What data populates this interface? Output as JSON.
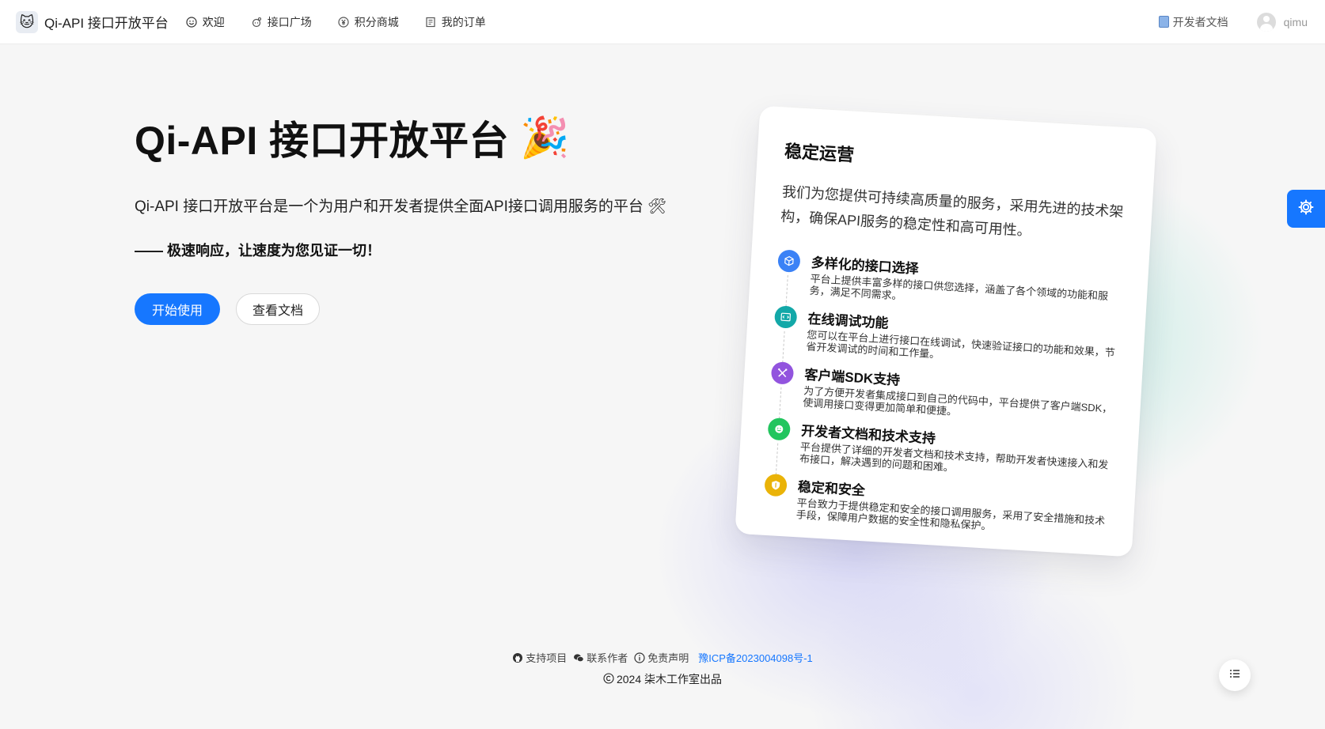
{
  "header": {
    "logo_title": "Qi-API 接口开放平台",
    "nav": [
      {
        "label": "欢迎",
        "icon": "smile-icon"
      },
      {
        "label": "接口广场",
        "icon": "api-icon"
      },
      {
        "label": "积分商城",
        "icon": "coin-icon"
      },
      {
        "label": "我的订单",
        "icon": "order-icon"
      }
    ],
    "doc_link": "开发者文档",
    "username": "qimu"
  },
  "hero": {
    "title": "Qi-API 接口开放平台",
    "title_emoji": "🎉",
    "description": "Qi-API 接口开放平台是一个为用户和开发者提供全面API接口调用服务的平台",
    "description_emoji": "🛠",
    "slogan": "—— 极速响应，让速度为您见证一切！",
    "start_button": "开始使用",
    "docs_button": "查看文档"
  },
  "card": {
    "title": "稳定运营",
    "description": "我们为您提供可持续高质量的服务，采用先进的技术架构，确保API服务的稳定性和高可用性。",
    "features": [
      {
        "title": "多样化的接口选择",
        "text": "平台上提供丰富多样的接口供您选择，涵盖了各个领域的功能和服务，满足不同需求。",
        "color": "#1677ff"
      },
      {
        "title": "在线调试功能",
        "text": "您可以在平台上进行接口在线调试，快速验证接口的功能和效果，节省开发调试的时间和工作量。",
        "color": "#13a8a8"
      },
      {
        "title": "客户端SDK支持",
        "text": "为了方便开发者集成接口到自己的代码中，平台提供了客户端SDK，使调用接口变得更加简单和便捷。",
        "color": "#9254de"
      },
      {
        "title": "开发者文档和技术支持",
        "text": "平台提供了详细的开发者文档和技术支持，帮助开发者快速接入和发布接口，解决遇到的问题和困难。",
        "color": "#22c55e"
      },
      {
        "title": "稳定和安全",
        "text": "平台致力于提供稳定和安全的接口调用服务，采用了安全措施和技术手段，保障用户数据的安全性和隐私保护。",
        "color": "#eab308"
      }
    ]
  },
  "footer": {
    "links": [
      {
        "label": "支持项目",
        "icon": "github-icon"
      },
      {
        "label": "联系作者",
        "icon": "wechat-icon"
      },
      {
        "label": "免责声明",
        "icon": "info-icon"
      }
    ],
    "icp": "豫ICP备2023004098号-1",
    "copyright": "2024 柒木工作室出品"
  }
}
